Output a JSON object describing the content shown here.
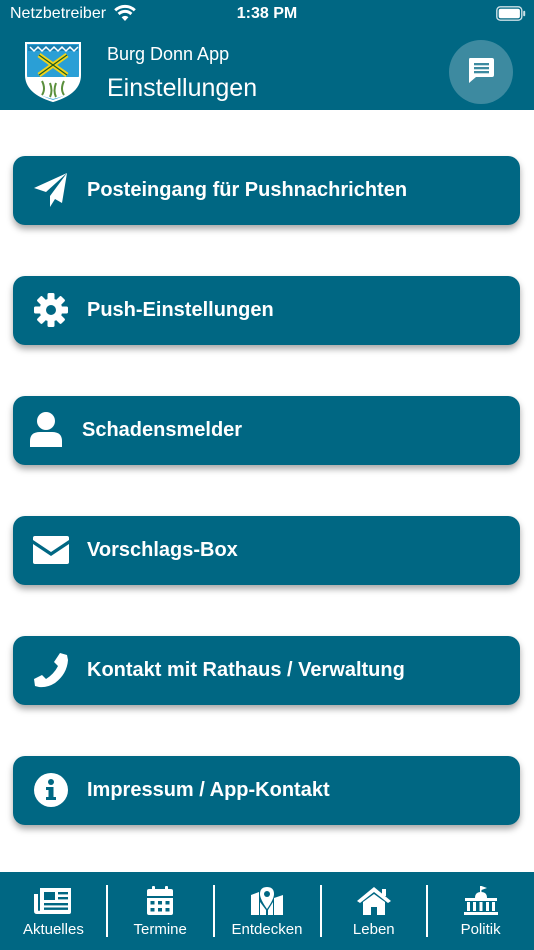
{
  "status_bar": {
    "carrier": "Netzbetreiber",
    "time": "1:38 PM"
  },
  "header": {
    "app_name": "Burg Donn App",
    "title": "Einstellungen"
  },
  "colors": {
    "primary": "#006783",
    "chat_button": "#3d8aa0",
    "text": "#ffffff",
    "background": "#ffffff"
  },
  "menu": [
    {
      "label": "Posteingang für Pushnachrichten",
      "icon": "paper-plane-icon"
    },
    {
      "label": "Push-Einstellungen",
      "icon": "gear-icon"
    },
    {
      "label": "Schadensmelder",
      "icon": "user-icon"
    },
    {
      "label": "Vorschlags-Box",
      "icon": "envelope-icon"
    },
    {
      "label": "Kontakt mit Rathaus / Verwaltung",
      "icon": "phone-icon"
    },
    {
      "label": "Impressum / App-Kontakt",
      "icon": "info-icon"
    }
  ],
  "tabs": [
    {
      "label": "Aktuelles",
      "icon": "newspaper-icon"
    },
    {
      "label": "Termine",
      "icon": "calendar-icon"
    },
    {
      "label": "Entdecken",
      "icon": "map-pin-icon"
    },
    {
      "label": "Leben",
      "icon": "house-icon"
    },
    {
      "label": "Politik",
      "icon": "town-hall-icon"
    }
  ]
}
